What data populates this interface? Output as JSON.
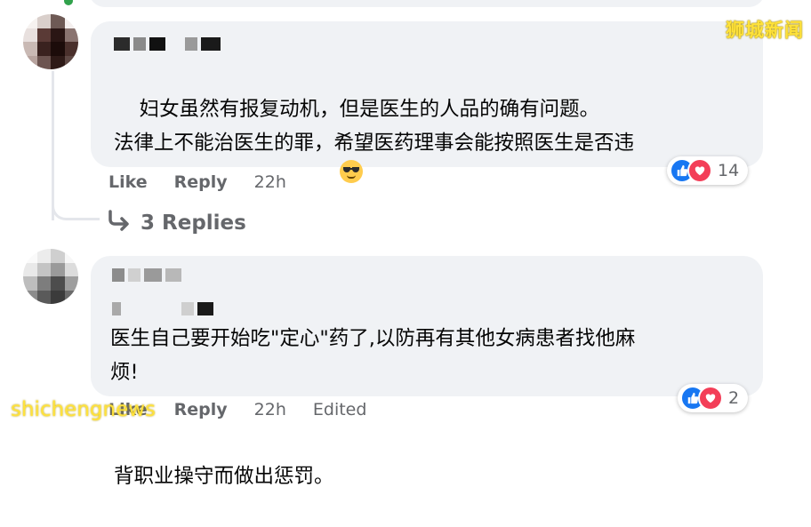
{
  "comments": [
    {
      "text": "妇女虽然有报复动机，但是医生的人品的确有问题。\n法律上不能治医生的罪，希望医药理事会能按照医生是否违\n背职业操守而做出惩罚。",
      "emoji": "😎",
      "like_label": "Like",
      "reply_label": "Reply",
      "time": "22h",
      "reaction_count": "14",
      "replies_label": "3 Replies"
    },
    {
      "text": "医生自己要开始吃\"定心\"药了,以防再有其他女病患者找他麻\n烦!",
      "like_label": "Like",
      "reply_label": "Reply",
      "time": "22h",
      "edited_label": "Edited",
      "reaction_count": "2"
    }
  ],
  "icons": {
    "like": "thumbs-up-icon",
    "love": "heart-icon",
    "replies_arrow": "reply-arrow-icon"
  },
  "colors": {
    "bubble": "#f0f2f5",
    "like_blue": "#1877f2",
    "love_red": "#f33e58",
    "meta_grey": "#65676b",
    "watermark_yellow": "#ffe23b"
  },
  "watermarks": {
    "top_right": "狮城新闻",
    "bottom_left": "shichengnews"
  }
}
